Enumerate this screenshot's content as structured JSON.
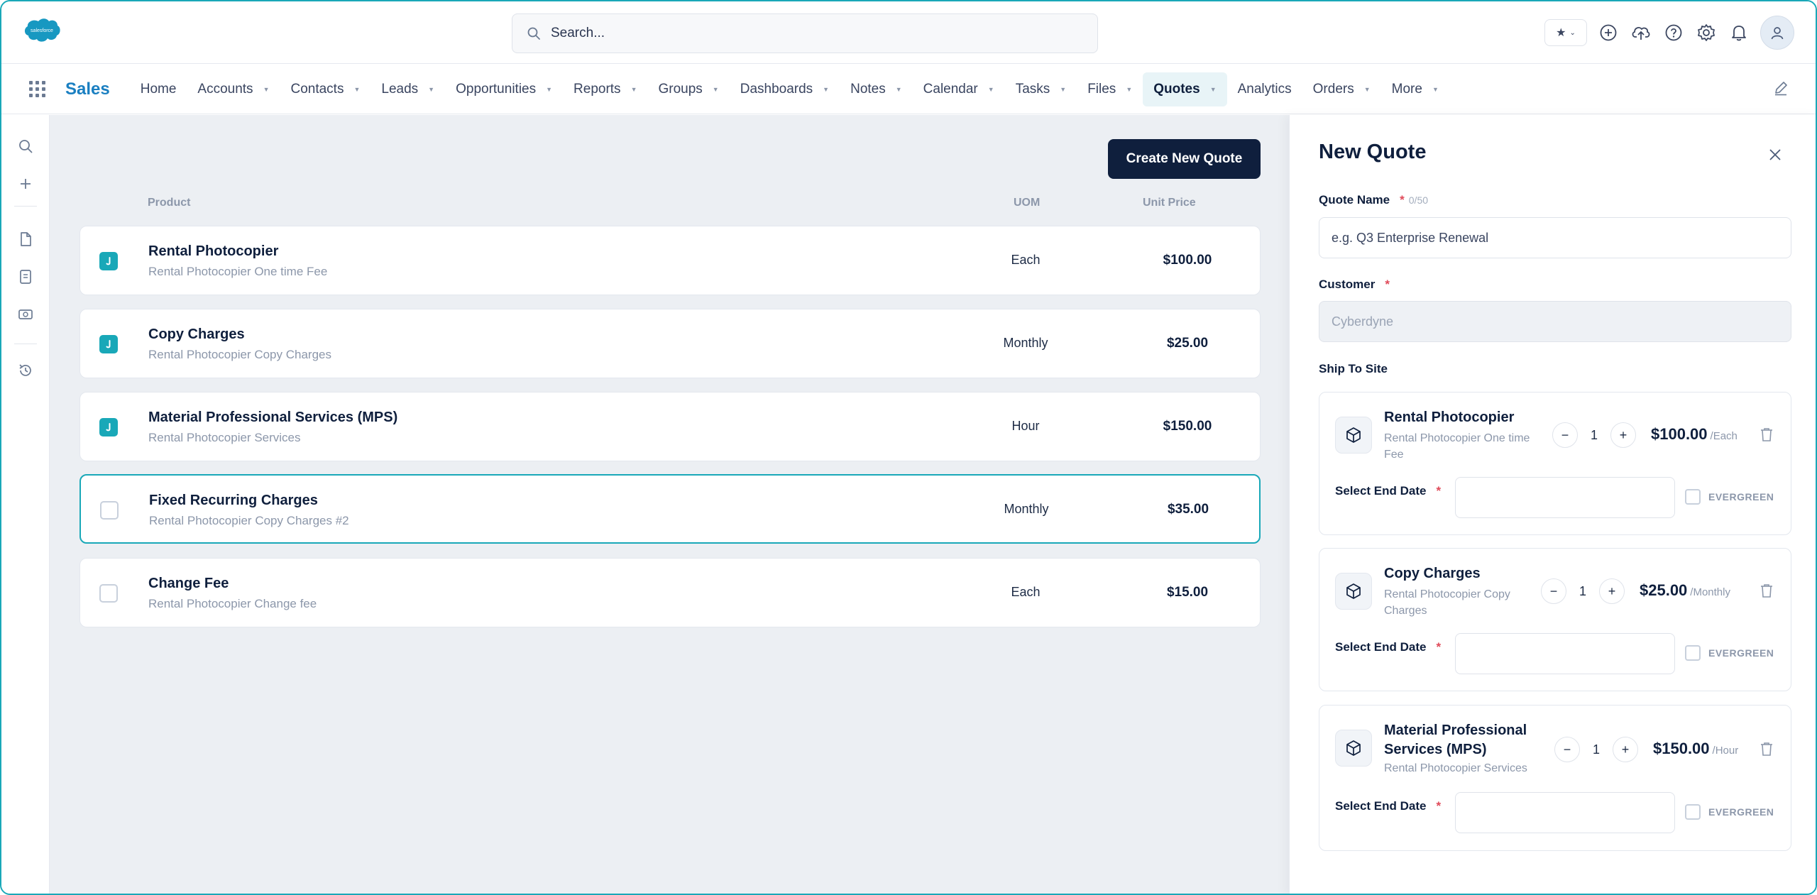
{
  "header": {
    "search_placeholder": "Search...",
    "favorites_icon": "star-icon",
    "actions": [
      "add-icon",
      "upload-cloud-icon",
      "help-icon",
      "settings-icon",
      "bell-icon",
      "user-avatar-icon"
    ]
  },
  "nav": {
    "app_name": "Sales",
    "items": [
      {
        "label": "Home",
        "has_menu": false
      },
      {
        "label": "Accounts",
        "has_menu": true
      },
      {
        "label": "Contacts",
        "has_menu": true
      },
      {
        "label": "Leads",
        "has_menu": true
      },
      {
        "label": "Opportunities",
        "has_menu": true
      },
      {
        "label": "Reports",
        "has_menu": true
      },
      {
        "label": "Groups",
        "has_menu": true
      },
      {
        "label": "Dashboards",
        "has_menu": true
      },
      {
        "label": "Notes",
        "has_menu": true
      },
      {
        "label": "Calendar",
        "has_menu": true
      },
      {
        "label": "Tasks",
        "has_menu": true
      },
      {
        "label": "Files",
        "has_menu": true
      },
      {
        "label": "Quotes",
        "has_menu": true,
        "active": true
      },
      {
        "label": "Analytics",
        "has_menu": false
      },
      {
        "label": "Orders",
        "has_menu": true
      },
      {
        "label": "More",
        "has_menu": true
      }
    ]
  },
  "main": {
    "create_button": "Create New Quote",
    "columns": {
      "product": "Product",
      "uom": "UOM",
      "unit_price": "Unit Price"
    },
    "products": [
      {
        "name": "Rental Photocopier",
        "description": "Rental Photocopier One time Fee",
        "uom": "Each",
        "price": "$100.00",
        "checked": true
      },
      {
        "name": "Copy Charges",
        "description": "Rental Photocopier Copy Charges",
        "uom": "Monthly",
        "price": "$25.00",
        "checked": true
      },
      {
        "name": "Material Professional Services (MPS)",
        "description": "Rental Photocopier Services",
        "uom": "Hour",
        "price": "$150.00",
        "checked": true
      },
      {
        "name": "Fixed Recurring Charges",
        "description": "Rental Photocopier Copy Charges #2",
        "uom": "Monthly",
        "price": "$35.00",
        "checked": false
      },
      {
        "name": "Change Fee",
        "description": "Rental Photocopier Change fee",
        "uom": "Each",
        "price": "$15.00",
        "checked": false
      }
    ]
  },
  "panel": {
    "title": "New Quote",
    "quote_name_label": "Quote Name",
    "required_mark": "*",
    "char_count": "0/50",
    "quote_name_placeholder": "e.g. Q3 Enterprise Renewal",
    "customer_label": "Customer",
    "customer_value": "Cyberdyne",
    "ship_to_label": "Ship To Site",
    "end_date_label": "Select End Date",
    "evergreen_label": "EVERGREEN",
    "line_items": [
      {
        "name": "Rental Photocopier",
        "description": "Rental Photocopier One time Fee",
        "qty": "1",
        "price": "$100.00",
        "unit": "/Each"
      },
      {
        "name": "Copy Charges",
        "description": "Rental Photocopier Copy Charges",
        "qty": "1",
        "price": "$25.00",
        "unit": "/Monthly"
      },
      {
        "name": "Material Professional Services (MPS)",
        "description": "Rental Photocopier Services",
        "qty": "1",
        "price": "$150.00",
        "unit": "/Hour"
      }
    ]
  },
  "colors": {
    "accent": "#19a8b8",
    "brand": "#1a7fc1",
    "primary_button": "#0f1f3d",
    "required": "#e04a59"
  }
}
